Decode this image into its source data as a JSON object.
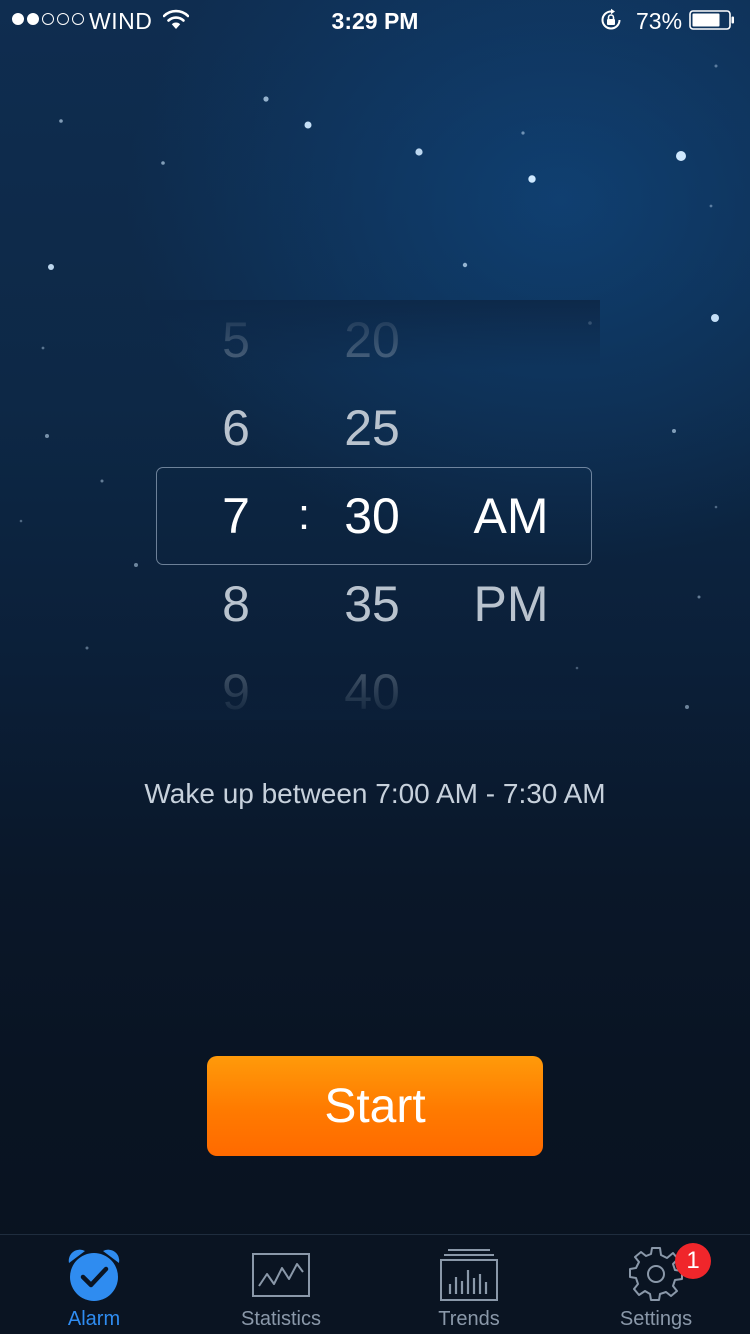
{
  "status_bar": {
    "carrier": "WIND",
    "signal_bars_filled": 2,
    "signal_bars_total": 5,
    "time": "3:29 PM",
    "battery_percent": "73%",
    "icons": [
      "wifi-icon",
      "rotation-lock-icon",
      "battery-icon"
    ]
  },
  "picker": {
    "hours": [
      "5",
      "6",
      "7",
      "8",
      "9"
    ],
    "separator": ":",
    "minutes": [
      "20",
      "25",
      "30",
      "35",
      "40"
    ],
    "periods": [
      "AM",
      "PM"
    ],
    "selected": {
      "hour": "7",
      "minute": "30",
      "period": "AM"
    }
  },
  "wake_window": "Wake up between 7:00 AM - 7:30 AM",
  "start_button": "Start",
  "tabs": [
    {
      "label": "Alarm",
      "icon": "alarm-clock-icon",
      "active": true
    },
    {
      "label": "Statistics",
      "icon": "statistics-chart-icon",
      "active": false
    },
    {
      "label": "Trends",
      "icon": "trends-bar-chart-icon",
      "active": false
    },
    {
      "label": "Settings",
      "icon": "gear-icon",
      "active": false,
      "badge": "1"
    }
  ],
  "colors": {
    "accent_blue": "#2f8cf0",
    "start_orange": "#ff7a00",
    "badge_red": "#f0262b",
    "background_top": "#0f2d50",
    "background_bottom": "#09121f"
  }
}
